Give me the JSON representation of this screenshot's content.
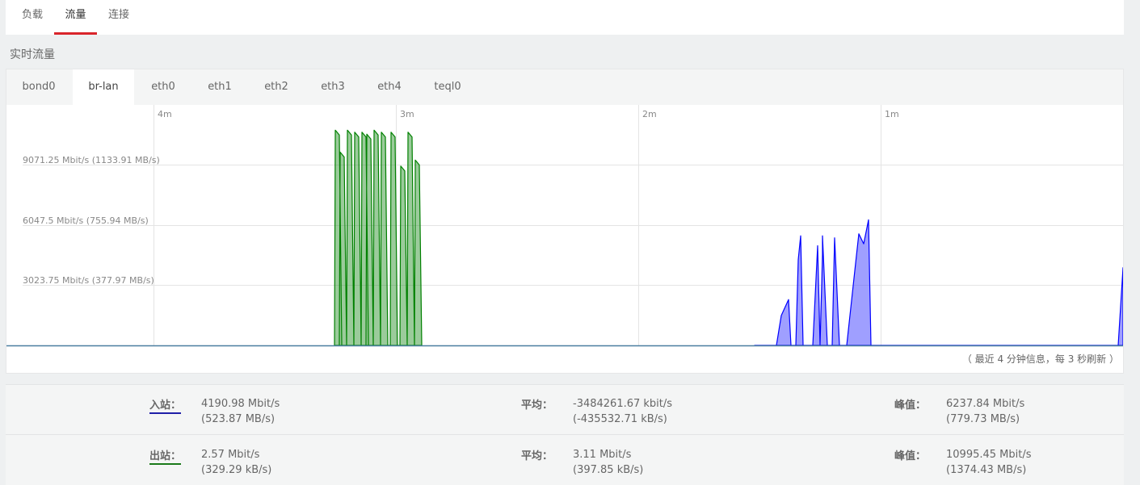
{
  "top_tabs": [
    "负载",
    "流量",
    "连接"
  ],
  "active_top_tab": "流量",
  "section_title": "实时流量",
  "interfaces": [
    "bond0",
    "br-lan",
    "eth0",
    "eth1",
    "eth2",
    "eth3",
    "eth4",
    "teql0"
  ],
  "active_interface": "br-lan",
  "chart": {
    "time_labels": [
      "4m",
      "3m",
      "2m",
      "1m"
    ],
    "y_labels": [
      "9071.25 Mbit/s (1133.91 MB/s)",
      "6047.5 Mbit/s (755.94 MB/s)",
      "3023.75 Mbit/s (377.97 MB/s)"
    ],
    "rx_color": "#0000ff",
    "tx_color": "#008000",
    "info": "（ 最近 4 分钟信息，每 3 秒刷新 ）"
  },
  "chart_data": {
    "type": "area",
    "x_unit": "minutes ago",
    "y_unit": "Mbit/s",
    "ylim": [
      0,
      12000
    ],
    "y_ticks": [
      3023.75,
      6047.5,
      9071.25
    ],
    "series": [
      {
        "name": "入站",
        "x": [
          1.52,
          1.48,
          1.43,
          1.41,
          1.38,
          1.37,
          1.35,
          1.34,
          1.33,
          1.32,
          1.28,
          1.26,
          1.25,
          1.24,
          1.24,
          1.22,
          1.21,
          1.2,
          1.19,
          1.17,
          1.14,
          1.1,
          1.09,
          1.07,
          1.05,
          1.04,
          1.0,
          0.99,
          0.96,
          0.93,
          0.9,
          0.88,
          0.85,
          0.82,
          0.81,
          0.78,
          0.76,
          0.73,
          0.7,
          0.67,
          0.64,
          0.62,
          0.6,
          0.58,
          0.55,
          0.52,
          0.5,
          0.47,
          0.45,
          0.42,
          0.38,
          0.34,
          0.32,
          0.3,
          0.28,
          0.27,
          0.24,
          0.21,
          0.19,
          0.16,
          0.14,
          0.12,
          0.1,
          0.09,
          0.06,
          0.05,
          0.03,
          0.02,
          0.0
        ],
        "y": [
          0,
          0,
          0,
          1500,
          2300,
          0,
          0,
          4300,
          5500,
          0,
          0,
          5000,
          0,
          4550,
          5500,
          0,
          0,
          0,
          5400,
          0,
          0,
          4500,
          5600,
          5100,
          6300,
          0,
          0,
          0,
          0,
          0,
          0,
          0,
          0,
          0,
          0,
          0,
          0,
          0,
          0,
          0,
          0,
          0,
          0,
          0,
          0,
          0,
          0,
          0,
          0,
          0,
          0,
          0,
          0,
          0,
          0,
          0,
          0,
          0,
          0,
          0,
          0,
          0,
          0,
          0,
          0,
          0,
          0,
          0,
          3900
        ]
      },
      {
        "name": "出站",
        "x": [
          3.25,
          3.23,
          3.2,
          3.17,
          3.14,
          3.12,
          3.09,
          3.06,
          3.02,
          2.98,
          2.95,
          2.92
        ],
        "y": [
          10800,
          9700,
          10800,
          10700,
          10700,
          10600,
          10800,
          10700,
          10700,
          9000,
          10700,
          9300
        ]
      }
    ]
  },
  "stats": {
    "rx": {
      "label": "入站：",
      "current": "4190.98 Mbit/s",
      "current_sub": "(523.87 MB/s)",
      "avg_label": "平均：",
      "avg": "-3484261.67 kbit/s",
      "avg_sub": "(-435532.71 kB/s)",
      "peak_label": "峰值：",
      "peak": "6237.84 Mbit/s",
      "peak_sub": "(779.73 MB/s)"
    },
    "tx": {
      "label": "出站：",
      "current": "2.57 Mbit/s",
      "current_sub": "(329.29 kB/s)",
      "avg_label": "平均：",
      "avg": "3.11 Mbit/s",
      "avg_sub": "(397.85 kB/s)",
      "peak_label": "峰值：",
      "peak": "10995.45 Mbit/s",
      "peak_sub": "(1374.43 MB/s)"
    }
  }
}
